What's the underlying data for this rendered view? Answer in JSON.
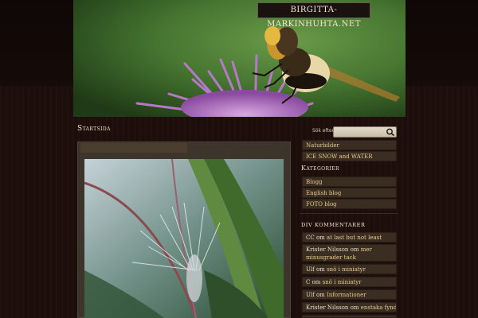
{
  "site": {
    "title": "BIRGITTA-MARKINHUHTA.NET"
  },
  "breadcrumb": "Startsida",
  "search": {
    "label": "Sök efter:",
    "value": ""
  },
  "sidebar": {
    "pages": [
      {
        "label": "Naturbilder"
      },
      {
        "label": "ICE SNOW and WATER"
      }
    ],
    "categories_heading": "Kategorier",
    "categories": [
      {
        "label": "Blogg"
      },
      {
        "label": "English blog"
      },
      {
        "label": "FOTO blog"
      }
    ],
    "comments_heading": "DIV KOMMENTARER",
    "comments": [
      {
        "author": "CC",
        "sep": "om",
        "post": "at last but not least"
      },
      {
        "author": "Krister Nilsson",
        "sep": "om",
        "post": "mer minusgrader tack"
      },
      {
        "author": "Ulf",
        "sep": "om",
        "post": "snö i miniatyr"
      },
      {
        "author": "C",
        "sep": "om",
        "post": "snö i miniatyr"
      },
      {
        "author": "Ulf",
        "sep": "om",
        "post": "Informationer"
      },
      {
        "author": "Krister Nilsson",
        "sep": "om",
        "post": "enstaka fynd"
      }
    ]
  },
  "colors": {
    "background": "#160c08",
    "sidebar_item": "#3a2e22",
    "link": "#e8c88c",
    "text": "#e8dcc8"
  }
}
